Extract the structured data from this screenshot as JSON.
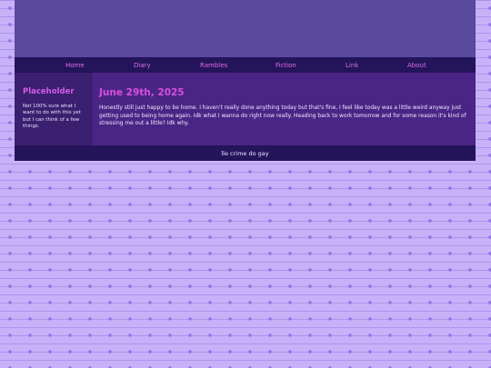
{
  "nav": {
    "items": [
      {
        "label": "Home"
      },
      {
        "label": "Diary"
      },
      {
        "label": "Rambles"
      },
      {
        "label": "Fiction"
      },
      {
        "label": "Link"
      },
      {
        "label": "About"
      }
    ]
  },
  "sidebar": {
    "title": "Placeholder",
    "text": "Not 100% sure what I want to do with this yet but I can think of a few things."
  },
  "post": {
    "title": "June 29th, 2025",
    "body": "Honestly still just happy to be home. I haven't really done anything today but that's fine, I feel like today was a little weird anyway just getting used to being home again. Idk what I wanna do right now really. Heading back to work tomorrow and for some reason it's kind of stressing me out a little? Idk why."
  },
  "footer": {
    "text": "île crime do gay"
  },
  "colors": {
    "page_background": "#c7b2f9",
    "header": "#5a4a9e",
    "nav_bar": "#24145a",
    "sidebar": "#3a206f",
    "main": "#4b2585",
    "accent_pink": "#d74fe0"
  }
}
